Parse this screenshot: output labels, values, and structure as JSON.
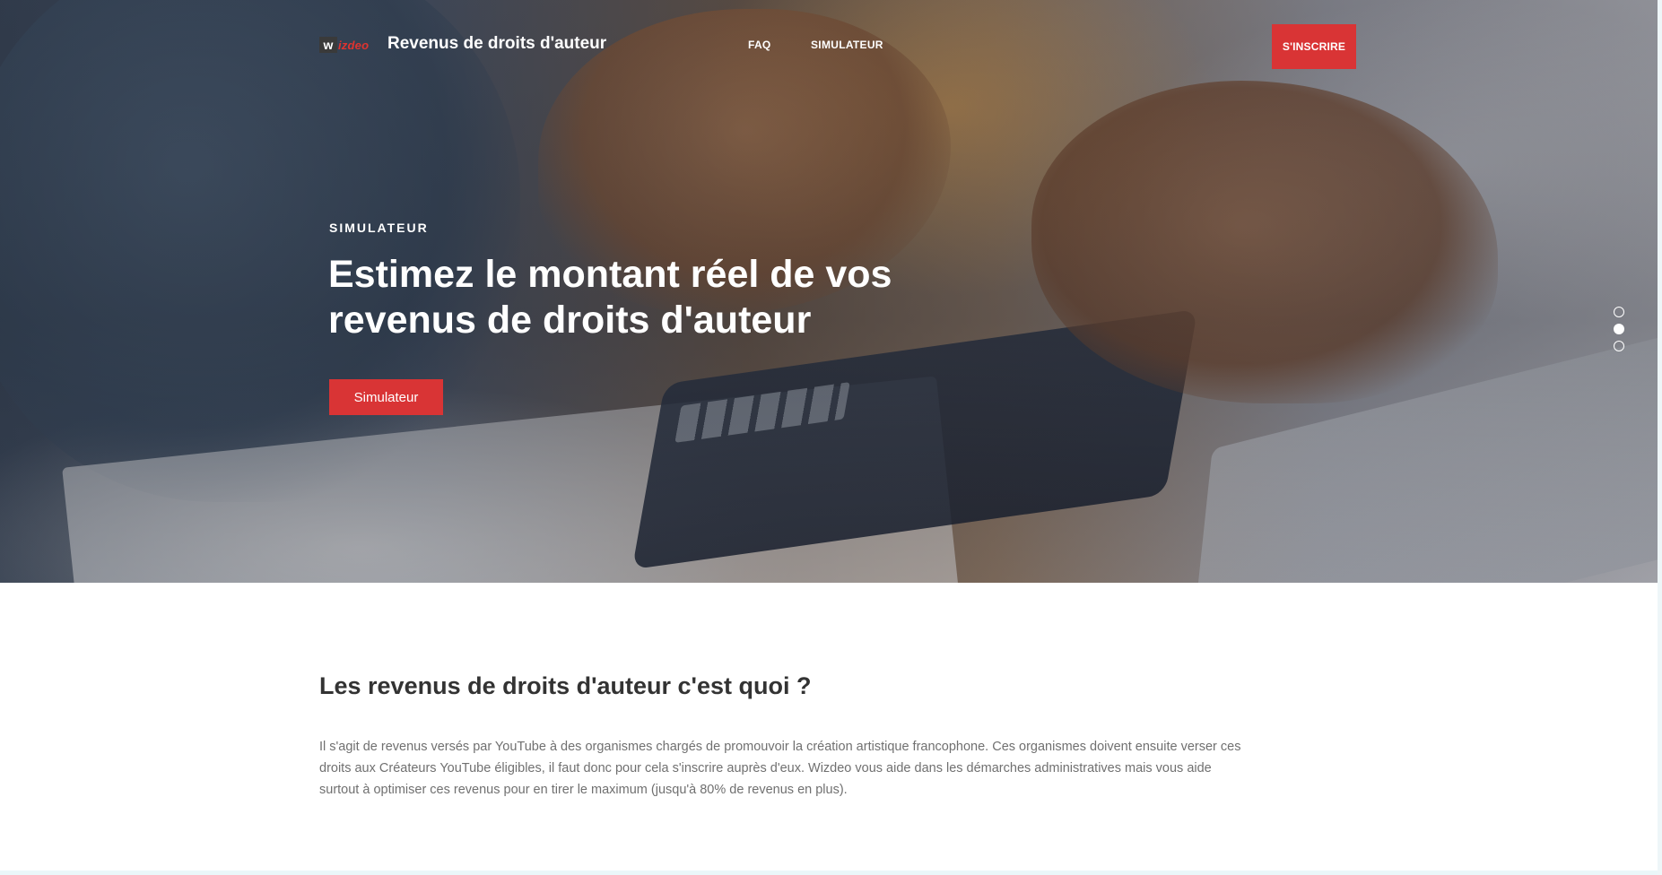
{
  "header": {
    "logo": {
      "mark": "w",
      "text": "izdeo"
    },
    "site_title": "Revenus de droits d'auteur",
    "nav": [
      {
        "label": "FAQ"
      },
      {
        "label": "SIMULATEUR"
      }
    ],
    "register_label": "S'INSCRIRE"
  },
  "hero": {
    "kicker": "SIMULATEUR",
    "headline_line1": "Estimez le montant réel de vos",
    "headline_line2": "revenus de droits d'auteur",
    "cta_label": "Simulateur",
    "slider": {
      "count": 3,
      "active_index": 1
    }
  },
  "section": {
    "title": "Les revenus de droits d'auteur c'est quoi ?",
    "body": "Il s'agit de revenus versés par YouTube à des organismes chargés de promouvoir la création artistique francophone. Ces organismes doivent ensuite verser ces droits aux Créateurs YouTube éligibles, il faut donc pour cela s'inscrire auprès d'eux. Wizdeo vous aide dans les démarches administratives mais vous aide surtout à optimiser ces revenus pour en tirer le maximum (jusqu'à 80% de revenus en plus)."
  },
  "colors": {
    "accent": "#d93435",
    "logo_red": "#e0332f",
    "heading": "#333333",
    "body_text": "#707070"
  }
}
